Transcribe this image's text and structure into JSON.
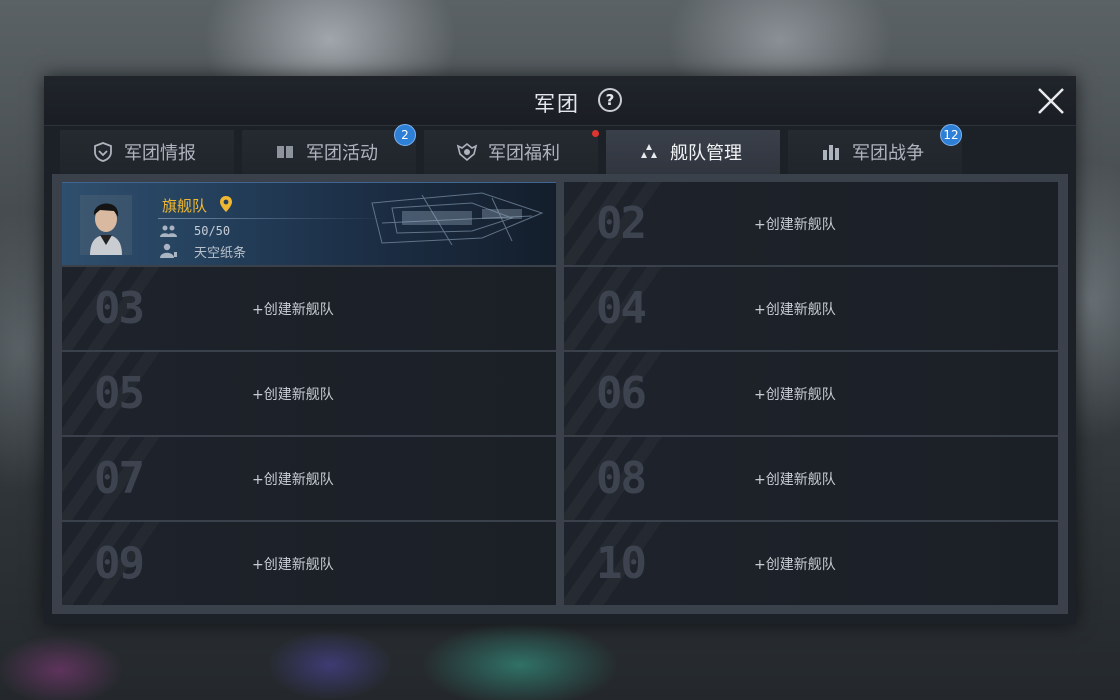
{
  "window": {
    "title": "军团"
  },
  "tabs": [
    {
      "label": "军团情报",
      "icon": "shield-icon",
      "badge": null,
      "active": false
    },
    {
      "label": "军团活动",
      "icon": "book-icon",
      "badge": "2",
      "active": false
    },
    {
      "label": "军团福利",
      "icon": "emblem-icon",
      "badge": null,
      "red_dot": true,
      "active": false
    },
    {
      "label": "舰队管理",
      "icon": "fleet-icon",
      "badge": null,
      "active": true
    },
    {
      "label": "军团战争",
      "icon": "war-icon",
      "badge": "12",
      "active": false
    }
  ],
  "flagship": {
    "name": "旗舰队",
    "members": "50/50",
    "leader": "天空纸条"
  },
  "slots": [
    {
      "number": "02",
      "label": "+创建新舰队"
    },
    {
      "number": "03",
      "label": "+创建新舰队"
    },
    {
      "number": "04",
      "label": "+创建新舰队"
    },
    {
      "number": "05",
      "label": "+创建新舰队"
    },
    {
      "number": "06",
      "label": "+创建新舰队"
    },
    {
      "number": "07",
      "label": "+创建新舰队"
    },
    {
      "number": "08",
      "label": "+创建新舰队"
    },
    {
      "number": "09",
      "label": "+创建新舰队"
    },
    {
      "number": "10",
      "label": "+创建新舰队"
    }
  ],
  "colors": {
    "accent_gold": "#f0b832",
    "badge_blue": "#2e7fd6",
    "red_dot": "#e0352e"
  }
}
